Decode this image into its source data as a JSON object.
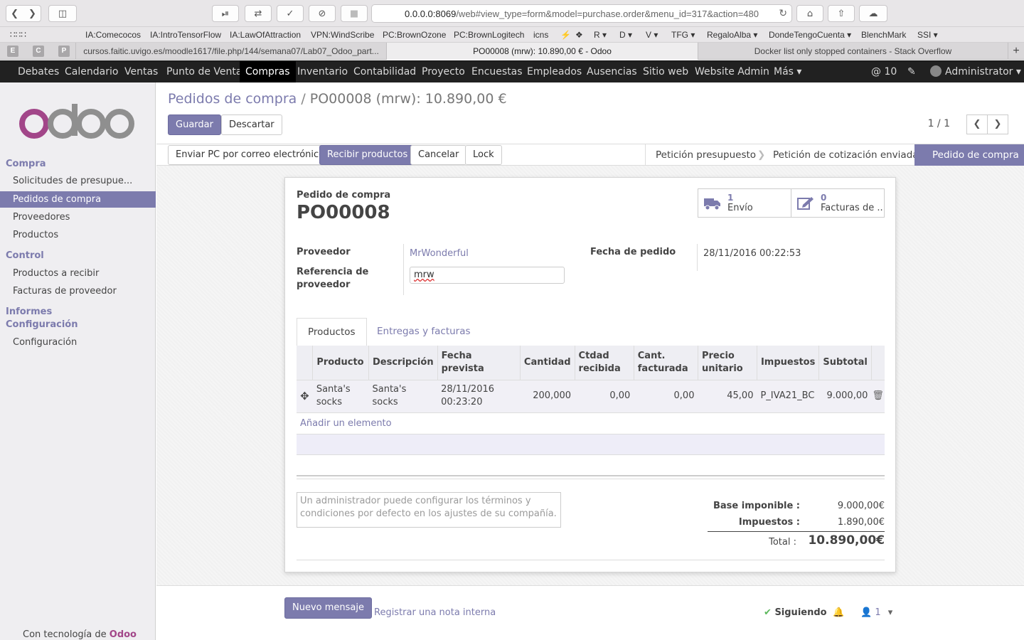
{
  "browser": {
    "url_host": "0.0.0.0:8069",
    "url_path": "/web#view_type=form&model=purchase.order&menu_id=317&action=480",
    "bookmarks": [
      "IA:Comecocos",
      "IA:IntroTensorFlow",
      "IA:LawOfAttraction",
      "VPN:WindScribe",
      "PC:BrownOzone",
      "PC:BrownLogitech",
      "icns",
      "⚡",
      "❖",
      "R ▾",
      "D ▾",
      "V ▾",
      "TFG ▾",
      "RegaloAlba ▾",
      "DondeTengoCuenta ▾",
      "BlenchMark",
      "SSI ▾"
    ],
    "pinned": [
      "E",
      "C",
      "P"
    ],
    "tabs": [
      "cursos.faitic.uvigo.es/moodle1617/file.php/144/semana07/Lab07_Odoo_part...",
      "PO00008 (mrw): 10.890,00 € - Odoo",
      "Docker list only stopped containers - Stack Overflow"
    ]
  },
  "topmenu": {
    "items": [
      "Debates",
      "Calendario",
      "Ventas",
      "Punto de Venta",
      "Compras",
      "Inventario",
      "Contabilidad",
      "Proyecto",
      "Encuestas",
      "Empleados",
      "Ausencias",
      "Sitio web",
      "Website Admin",
      "Más ▾"
    ],
    "mentions": "@ 10",
    "user": "Administrator ▾"
  },
  "sidebar": {
    "section_compra": "Compra",
    "compra_items": [
      "Solicitudes de presupue...",
      "Pedidos de compra",
      "Proveedores",
      "Productos"
    ],
    "section_control": "Control",
    "control_items": [
      "Productos a recibir",
      "Facturas de proveedor"
    ],
    "section_informes": "Informes",
    "section_config": "Configuración",
    "config_items": [
      "Configuración"
    ],
    "powered_prefix": "Con tecnología de",
    "powered_brand": "Odoo"
  },
  "header": {
    "breadcrumb_parent": "Pedidos de compra",
    "breadcrumb_current": "PO00008 (mrw): 10.890,00 €",
    "save_label": "Guardar",
    "discard_label": "Descartar",
    "pager": "1 / 1"
  },
  "actions": {
    "send_email": "Enviar PC por correo electrónico",
    "receive": "Recibir productos",
    "cancel": "Cancelar",
    "lock": "Lock"
  },
  "stages": [
    "Petición presupuesto",
    "Petición de cotización enviada",
    "Pedido de compra"
  ],
  "form": {
    "doc_label": "Pedido de compra",
    "doc_number": "PO00008",
    "smart_buttons": [
      {
        "count": "1",
        "label": "Envío",
        "icon": "truck-icon"
      },
      {
        "count": "0",
        "label": "Facturas de ...",
        "icon": "edit-icon"
      }
    ],
    "supplier_label": "Proveedor",
    "supplier_value": "MrWonderful",
    "supplier_ref_label": "Referencia de proveedor",
    "supplier_ref_value": "mrw",
    "order_date_label": "Fecha de pedido",
    "order_date_value": "28/11/2016 00:22:53"
  },
  "notebook": {
    "tabs": [
      "Productos",
      "Entregas y facturas"
    ]
  },
  "lines": {
    "headers": [
      "Producto",
      "Descripción",
      "Fecha prevista",
      "Cantidad",
      "Ctdad recibida",
      "Cant. facturada",
      "Precio unitario",
      "Impuestos",
      "Subtotal"
    ],
    "rows": [
      {
        "product": "Santa's socks",
        "description": "Santa's socks",
        "date": "28/11/2016 00:23:20",
        "qty": "200,000",
        "received": "0,00",
        "invoiced": "0,00",
        "price": "45,00",
        "taxes": "P_IVA21_BC",
        "subtotal": "9.000,00"
      }
    ],
    "add_line": "Añadir un elemento"
  },
  "terms_placeholder": "Un administrador puede configurar los términos y condiciones por defecto en los ajustes de su compañía.",
  "totals": {
    "base_label": "Base imponible :",
    "base_value": "9.000,00€",
    "tax_label": "Impuestos :",
    "tax_value": "1.890,00€",
    "total_label": "Total :",
    "total_value": "10.890,00€"
  },
  "chatter": {
    "new_message": "Nuevo mensaje",
    "log_note": "Registrar una nota interna",
    "following": "Siguiendo",
    "followers": "1"
  },
  "colors": {
    "accent": "#7c7bad",
    "topbar": "#212121",
    "brand": "#a24689"
  }
}
